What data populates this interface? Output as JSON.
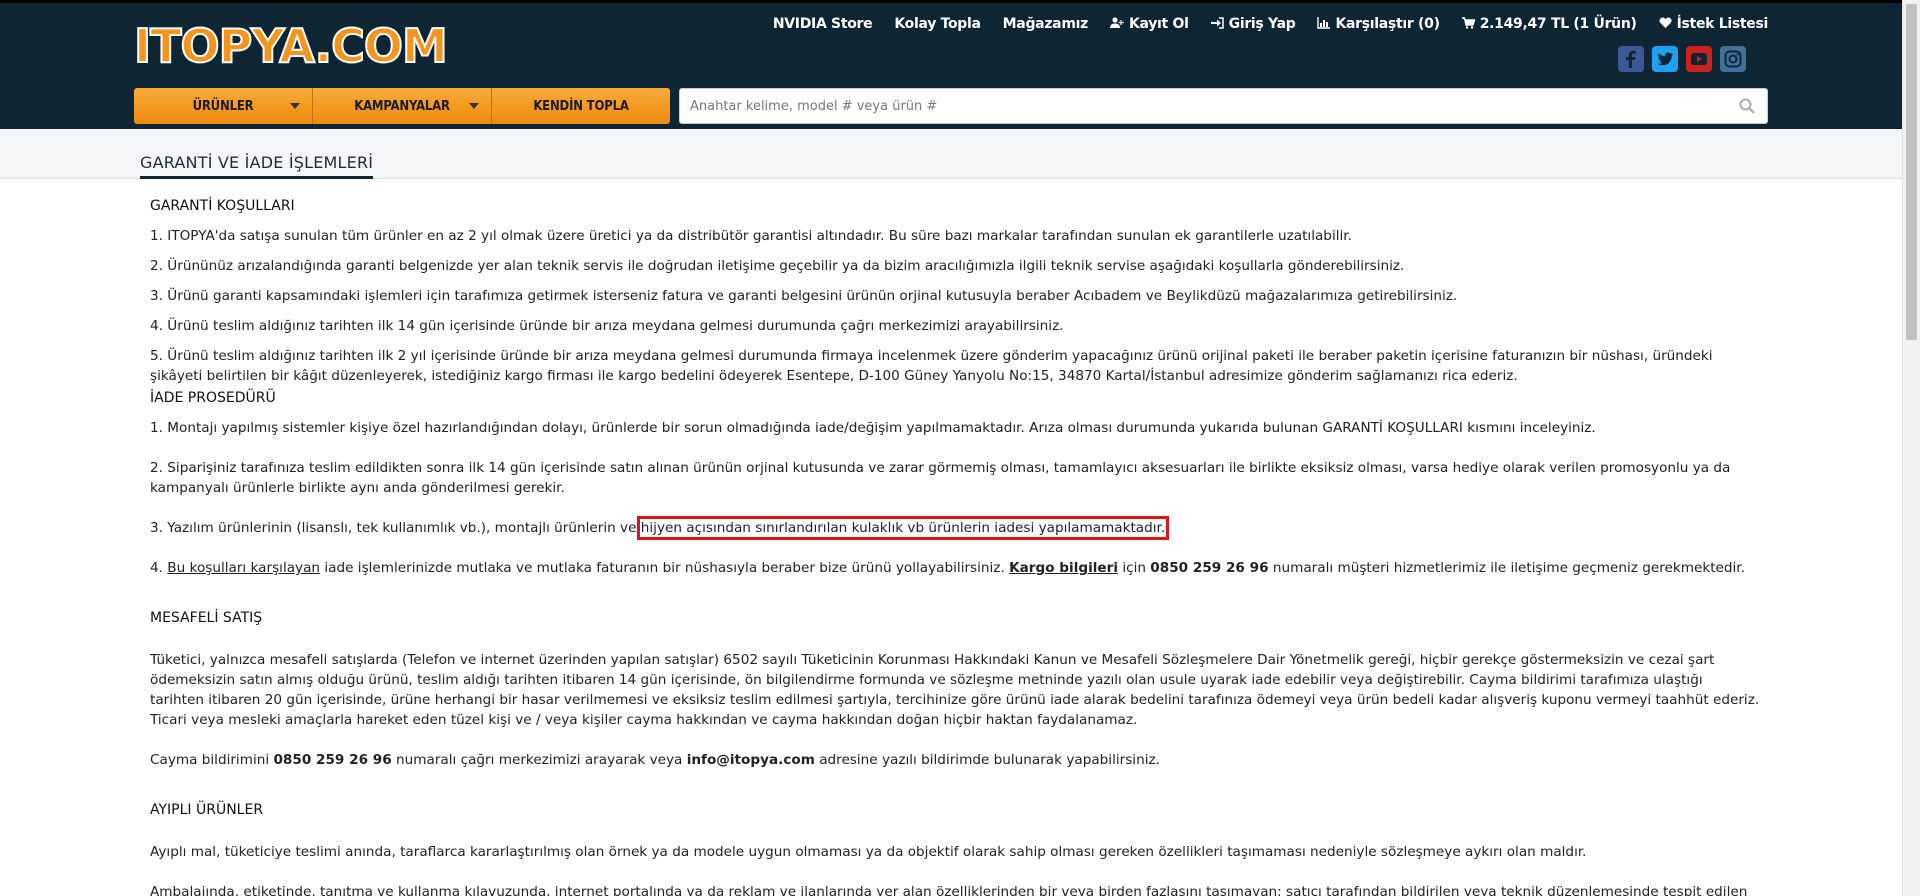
{
  "brand": {
    "logo_text": "ITOPYA.COM"
  },
  "topnav": [
    {
      "label": "NVIDIA Store",
      "icon": ""
    },
    {
      "label": "Kolay Topla",
      "icon": ""
    },
    {
      "label": "Mağazamız",
      "icon": ""
    },
    {
      "label": "Kayıt Ol",
      "icon": "user-plus-icon"
    },
    {
      "label": "Giriş Yap",
      "icon": "sign-in-icon"
    },
    {
      "label": "Karşılaştır (0)",
      "icon": "bar-chart-icon"
    },
    {
      "label": "2.149,47 TL (1 Ürün)",
      "icon": "cart-icon"
    },
    {
      "label": "İstek Listesi",
      "icon": "heart-icon"
    }
  ],
  "social": [
    {
      "name": "facebook-icon",
      "color": "#3b5998",
      "glyph": "f"
    },
    {
      "name": "twitter-icon",
      "color": "#1da1f2",
      "glyph": "t"
    },
    {
      "name": "youtube-icon",
      "color": "#cd201f",
      "glyph": "▶"
    },
    {
      "name": "instagram-icon",
      "color": "#3f729b",
      "glyph": "◎"
    }
  ],
  "navbar": {
    "products": "ÜRÜNLER",
    "campaigns": "KAMPANYALAR",
    "build": "KENDİN TOPLA"
  },
  "search": {
    "placeholder": "Anahtar kelime, model # veya ürün #"
  },
  "page": {
    "title": "GARANTİ VE İADE İŞLEMLERİ"
  },
  "warranty": {
    "heading": "GARANTİ KOŞULLARI",
    "items": [
      "1. ITOPYA'da satışa sunulan tüm ürünler en az 2 yıl olmak üzere üretici ya da distribütör garantisi altındadır. Bu süre bazı markalar tarafından sunulan ek garantilerle uzatılabilir.",
      "2. Ürününüz arızalandığında garanti belgenizde yer alan teknik servis ile doğrudan iletişime geçebilir ya da bizim aracılığımızla ilgili teknik servise aşağıdaki koşullarla gönderebilirsiniz.",
      "3. Ürünü garanti kapsamındaki işlemleri için tarafımıza getirmek isterseniz fatura ve garanti belgesini ürünün orjinal kutusuyla beraber Acıbadem ve Beylikdüzü mağazalarımıza getirebilirsiniz.",
      "4. Ürünü teslim aldığınız tarihten ilk 14 gün içerisinde üründe bir arıza meydana gelmesi durumunda çağrı merkezimizi arayabilirsiniz.",
      "5. Ürünü teslim aldığınız tarihten ilk 2 yıl içerisinde üründe bir arıza meydana gelmesi durumunda firmaya incelenmek üzere gönderim yapacağınız ürünü orijinal paketi ile beraber paketin içerisine faturanızın bir nüshası, üründeki şikâyeti belirtilen bir kâğıt düzenleyerek, istediğiniz kargo firması ile kargo bedelini ödeyerek Esentepe, D-100 Güney Yanyolu No:15, 34870 Kartal/İstanbul adresimize gönderim sağlamanızı rica ederiz."
    ]
  },
  "returns": {
    "heading": "İADE PROSEDÜRÜ",
    "item1": "1. Montajı yapılmış sistemler kişiye özel hazırlandığından dolayı, ürünlerde bir sorun olmadığında iade/değişim yapılmamaktadır. Arıza olması durumunda yukarıda bulunan GARANTİ KOŞULLARI kısmını inceleyiniz.",
    "item2": "2. Siparişiniz tarafınıza teslim edildikten sonra ilk 14 gün içerisinde satın alınan ürünün orjinal kutusunda ve zarar görmemiş olması, tamamlayıcı aksesuarları ile birlikte eksiksiz olması, varsa hediye olarak verilen promosyonlu ya da kampanyalı ürünlerle birlikte aynı anda gönderilmesi gerekir.",
    "item3_pre": "3. Yazılım ürünlerinin (lisanslı, tek kullanımlık vb.), montajlı ürünlerin ve ",
    "item3_highlight": "hijyen açısından sınırlandırılan kulaklık vb ürünlerin iadesi yapılamamaktadır.",
    "item4_num": "4. ",
    "item4_link1": "Bu koşulları karşılayan",
    "item4_mid": " iade işlemlerinizde mutlaka ve mutlaka faturanın bir nüshasıyla beraber bize ürünü yollayabilirsiniz. ",
    "item4_link2": "Kargo bilgileri",
    "item4_mid2": " için ",
    "item4_phone": "0850 259 26 96",
    "item4_end": " numaralı müşteri hizmetlerimiz ile iletişime geçmeniz gerekmektedir."
  },
  "distance": {
    "heading": "MESAFELİ SATIŞ",
    "para": "Tüketici, yalnızca mesafeli satışlarda (Telefon ve internet üzerinden yapılan satışlar) 6502 sayılı Tüketicinin Korunması Hakkındaki Kanun ve Mesafeli Sözleşmelere Dair Yönetmelik gereği, hiçbir gerekçe göstermeksizin ve cezai şart ödemeksizin satın almış olduğu ürünü, teslim aldığı tarihten itibaren 14 gün içerisinde, ön bilgilendirme formunda ve sözleşme metninde yazılı olan usule uyarak iade edebilir veya değiştirebilir. Cayma bildirimi tarafımıza ulaştığı tarihten itibaren 20 gün içerisinde, ürüne herhangi bir hasar verilmemesi ve eksiksiz teslim edilmesi şartıyla, tercihinize göre ürünü iade alarak bedelini tarafınıza ödemeyi veya ürün bedeli kadar alışveriş kuponu vermeyi taahhüt ederiz. Ticari veya mesleki amaçlarla hareket eden tüzel kişi ve / veya kişiler cayma hakkından ve cayma hakkından doğan hiçbir haktan faydalanamaz.",
    "cancel_pre": "Cayma bildirimini ",
    "cancel_phone": "0850 259 26 96",
    "cancel_mid": " numaralı çağrı merkezimizi arayarak veya ",
    "cancel_email": "info@itopya.com",
    "cancel_end": " adresine yazılı bildirimde bulunarak yapabilirsiniz."
  },
  "defective": {
    "heading": "AYIPLI ÜRÜNLER",
    "para1": "Ayıplı mal, tüketiciye teslimi anında, taraflarca kararlaştırılmış olan örnek ya da modele uygun olmaması ya da objektif olarak sahip olması gereken özellikleri taşımaması nedeniyle sözleşmeye aykırı olan maldır.",
    "para2": "Ambalajında, etiketinde, tanıtma ve kullanma kılavuzunda, internet portalında ya da reklam ve ilanlarında yer alan özelliklerinden bir veya birden fazlasını taşımayan; satıcı tarafından bildirilen veya teknik düzenlemesinde tespit edilen niteliğe aykırı"
  }
}
